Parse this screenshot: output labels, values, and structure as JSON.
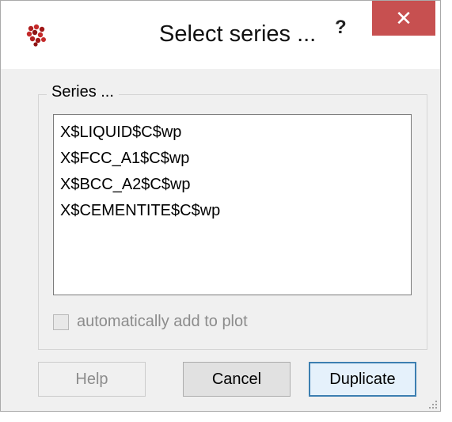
{
  "window": {
    "title": "Select series ...",
    "help_glyph": "?",
    "close_glyph": "✕",
    "icons": {
      "app": "molecule-cluster-icon",
      "close": "close-icon",
      "grip": "resize-grip-icon"
    },
    "colors": {
      "close_bg": "#c75050",
      "default_border": "#3c7fb1"
    }
  },
  "group": {
    "title": "Series ...",
    "series": [
      "X$LIQUID$C$wp",
      "X$FCC_A1$C$wp",
      "X$BCC_A2$C$wp",
      "X$CEMENTITE$C$wp"
    ],
    "auto_add": {
      "label": "automatically add to plot",
      "checked": false,
      "enabled": false
    }
  },
  "buttons": {
    "help": "Help",
    "cancel": "Cancel",
    "duplicate": "Duplicate"
  }
}
